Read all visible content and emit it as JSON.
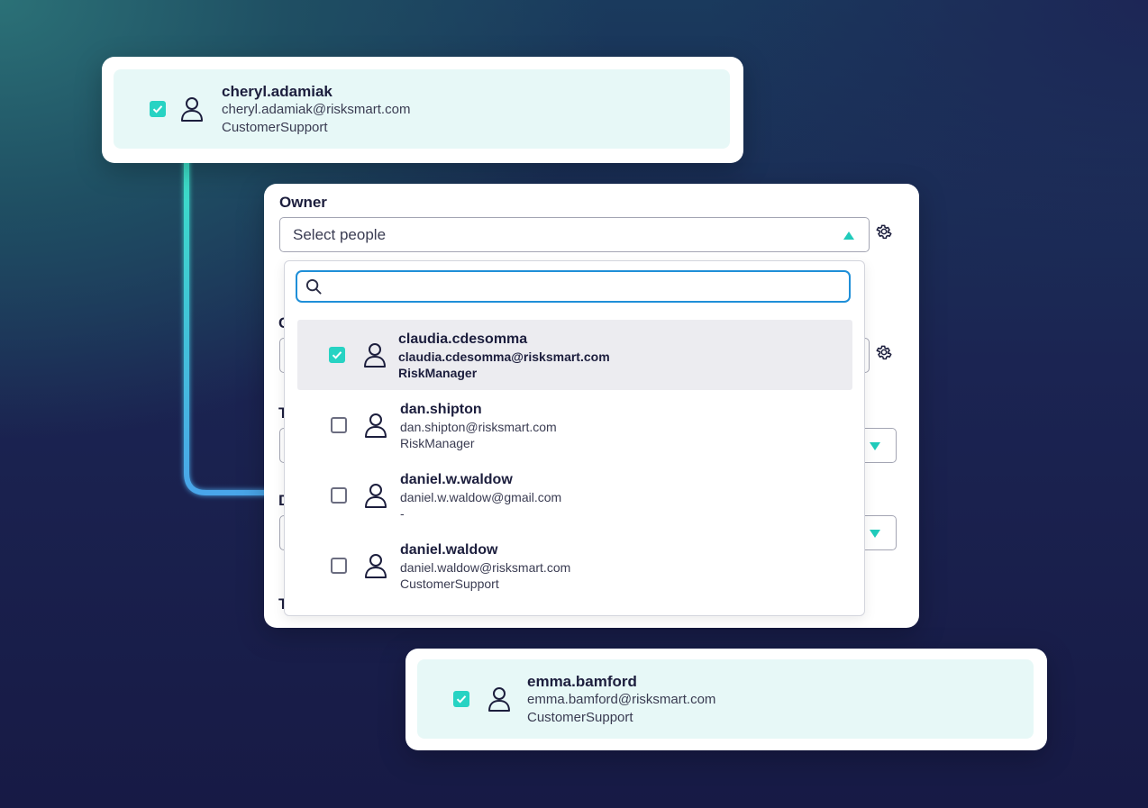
{
  "top_card": {
    "name": "cheryl.adamiak",
    "email": "cheryl.adamiak@risksmart.com",
    "role": "CustomerSupport",
    "checked": true
  },
  "owner_panel": {
    "label": "Owner",
    "select_placeholder": "Select people",
    "search_placeholder": "",
    "partial_labels": [
      "C",
      "T",
      "D",
      "T"
    ],
    "options": [
      {
        "name": "claudia.cdesomma",
        "email": "claudia.cdesomma@risksmart.com",
        "role": "RiskManager",
        "checked": true
      },
      {
        "name": "dan.shipton",
        "email": "dan.shipton@risksmart.com",
        "role": "RiskManager",
        "checked": false
      },
      {
        "name": "daniel.w.waldow",
        "email": "daniel.w.waldow@gmail.com",
        "role": "-",
        "checked": false
      },
      {
        "name": "daniel.waldow",
        "email": "daniel.waldow@risksmart.com",
        "role": "CustomerSupport",
        "checked": false
      }
    ]
  },
  "bottom_card": {
    "name": "emma.bamford",
    "email": "emma.bamford@risksmart.com",
    "role": "CustomerSupport",
    "checked": true
  },
  "colors": {
    "accent": "#27d3c3",
    "focus": "#1f8fd8",
    "tile_bg": "#e7f8f7"
  },
  "icons": {
    "person": "person-icon",
    "check": "check-icon",
    "gear": "gear-icon",
    "search": "search-icon"
  }
}
